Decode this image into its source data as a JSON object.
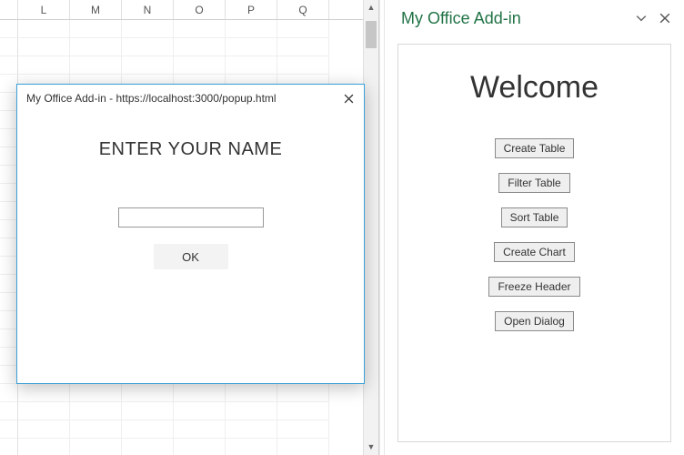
{
  "sheet": {
    "columns": [
      "L",
      "M",
      "N",
      "O",
      "P",
      "Q"
    ]
  },
  "taskpane": {
    "title": "My Office Add-in",
    "welcome": "Welcome",
    "buttons": {
      "create_table": "Create Table",
      "filter_table": "Filter Table",
      "sort_table": "Sort Table",
      "create_chart": "Create Chart",
      "freeze_header": "Freeze Header",
      "open_dialog": "Open Dialog"
    }
  },
  "dialog": {
    "title": "My Office Add-in - https://localhost:3000/popup.html",
    "heading": "ENTER YOUR NAME",
    "input_value": "",
    "ok_label": "OK"
  }
}
